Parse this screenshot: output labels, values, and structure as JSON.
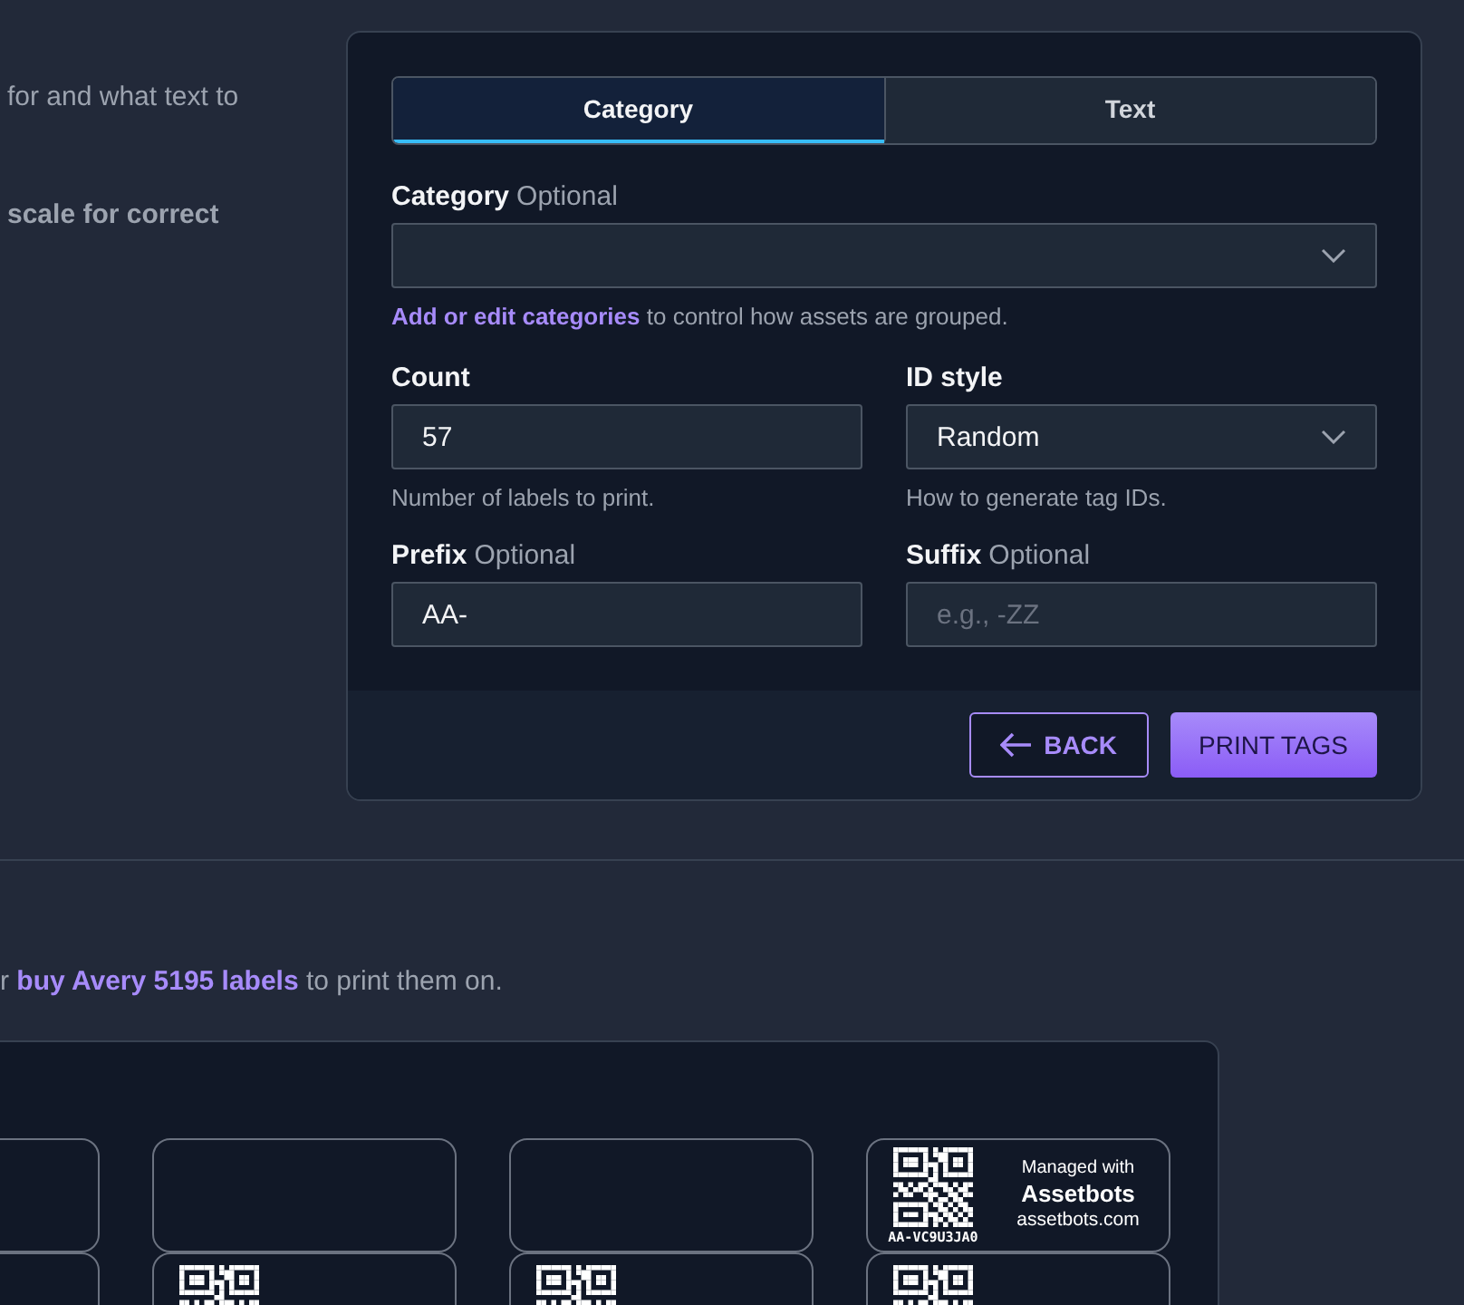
{
  "intro": {
    "line_1": "for and what text to",
    "line_2": "scale for correct"
  },
  "panel": {
    "tabs": [
      {
        "label": "Category",
        "selected": true
      },
      {
        "label": "Text",
        "selected": false
      }
    ],
    "category": {
      "label": "Category",
      "note": "Optional",
      "help_link": "Add or edit categories",
      "help": "to control how assets are grouped."
    },
    "fields": [
      {
        "kind": "input",
        "label": "Count",
        "value": "57",
        "help": "Number of labels to print."
      },
      {
        "kind": "select",
        "label": "ID style",
        "value": "Random",
        "help": "How to generate tag IDs."
      },
      {
        "kind": "input",
        "label": "Prefix",
        "note": "Optional",
        "value": "AA-"
      },
      {
        "kind": "input",
        "label": "Suffix",
        "note": "Optional",
        "placeholder": "e.g., -ZZ"
      }
    ],
    "buttons": [
      {
        "kind": "back",
        "label": "BACK"
      },
      {
        "kind": "primary",
        "label": "PRINT TAGS"
      }
    ]
  },
  "purchase_note": {
    "prefix": "r",
    "link": "buy Avery 5195 labels",
    "suffix": "to print them on."
  },
  "label_sheet": {
    "rows": [
      {
        "labels": [
          {
            "kind": "blank"
          },
          {
            "kind": "blank"
          },
          {
            "kind": "blank"
          },
          {
            "kind": "tag",
            "tag_id": "AA-VC9U3JA0",
            "managed_with": "Managed with",
            "brand": "Assetbots",
            "website": "assetbots.com"
          }
        ]
      },
      {
        "labels": [
          {
            "kind": "blank"
          },
          {
            "kind": "qr"
          },
          {
            "kind": "qr"
          },
          {
            "kind": "qr"
          }
        ]
      }
    ]
  }
}
